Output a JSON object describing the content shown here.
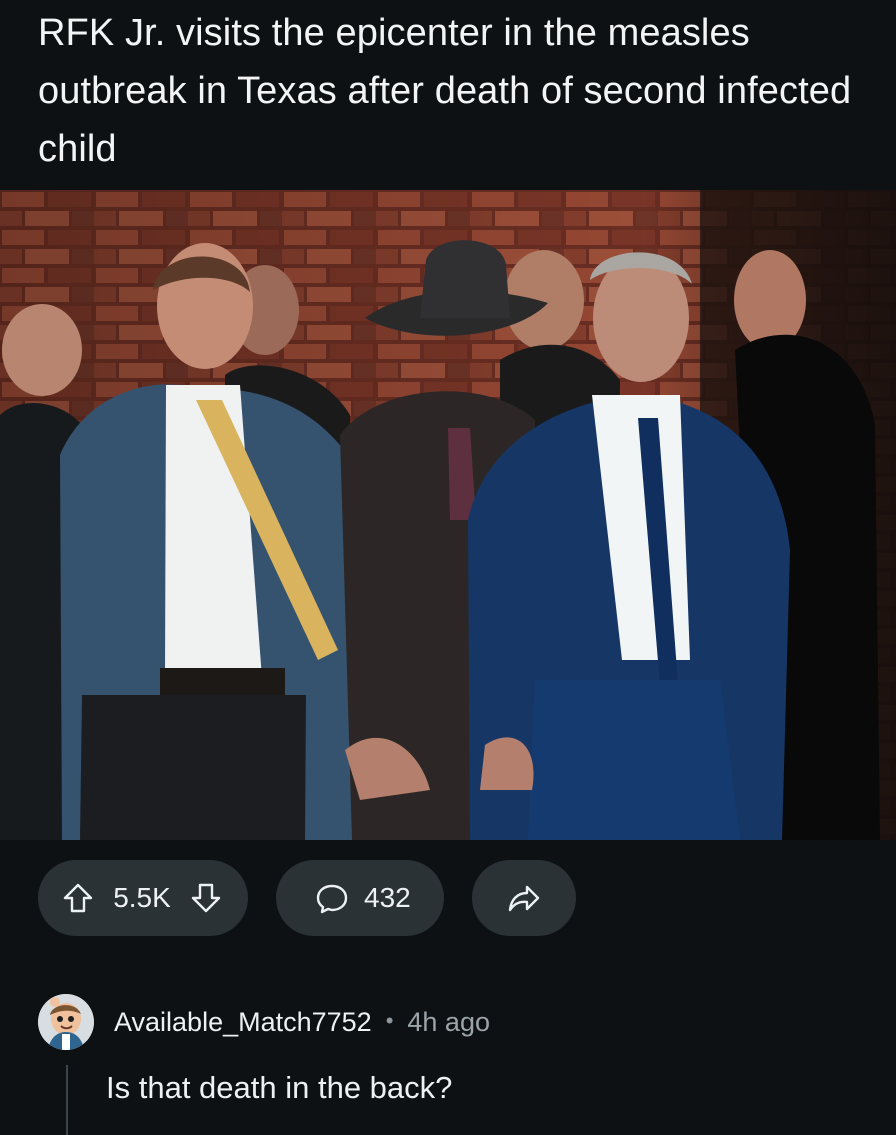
{
  "post": {
    "title": "RFK Jr. visits the epicenter in the measles outbreak in Texas after death of second infected child"
  },
  "actions": {
    "upvote_icon": "upvote-arrow-icon",
    "vote_count": "5.5K",
    "downvote_icon": "downvote-arrow-icon",
    "comment_icon": "comment-bubble-icon",
    "comment_count": "432",
    "share_icon": "share-arrow-icon"
  },
  "comment": {
    "author": "Available_Match7752",
    "separator": "•",
    "timestamp": "4h ago",
    "body": "Is that death in the back?"
  },
  "colors": {
    "background": "#0e1113",
    "pill": "#2a3236",
    "text": "#eef1f3",
    "muted": "#9aa4a9"
  }
}
